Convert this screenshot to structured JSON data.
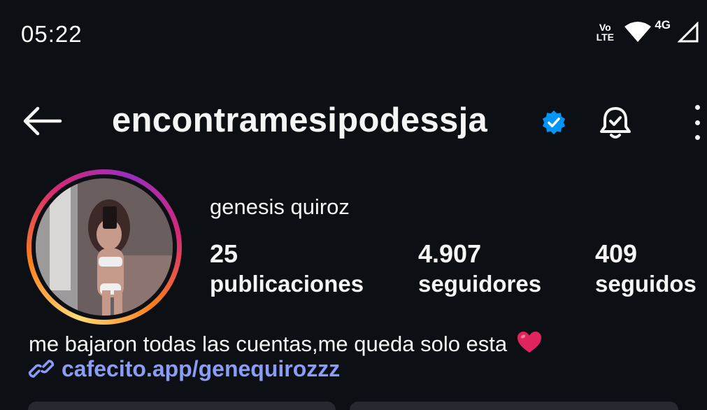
{
  "status_bar": {
    "time": "05:22",
    "volte_top": "Vo",
    "volte_bottom": "LTE",
    "network": "4G"
  },
  "header": {
    "username": "encontramesipodessja",
    "verified_color": "#0095f6"
  },
  "profile": {
    "display_name": "genesis quiroz",
    "stats": {
      "posts_value": "25",
      "posts_label": "publicaciones",
      "followers_value": "4.907",
      "followers_label": "seguidores",
      "following_value": "409",
      "following_label": "seguidos"
    },
    "bio": "me bajaron todas las cuentas,me queda solo esta",
    "link": "cafecito.app/genequirozzz"
  },
  "colors": {
    "background": "#0c1014",
    "text": "#f5f5f5",
    "link": "#8a9cf5",
    "heart": "#e0245e"
  },
  "icons": [
    "back-arrow-icon",
    "verified-badge-icon",
    "bell-check-icon",
    "more-options-icon",
    "link-icon",
    "heart-emoji-icon",
    "wifi-icon",
    "signal-icon"
  ]
}
